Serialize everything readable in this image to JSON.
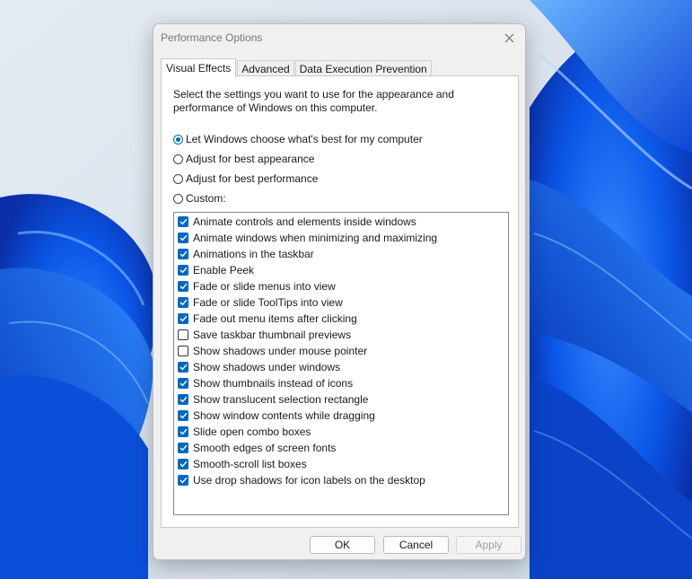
{
  "dialog": {
    "title": "Performance Options",
    "tabs": [
      {
        "label": "Visual Effects",
        "active": true
      },
      {
        "label": "Advanced",
        "active": false
      },
      {
        "label": "Data Execution Prevention",
        "active": false
      }
    ],
    "description": "Select the settings you want to use for the appearance and performance of Windows on this computer.",
    "radios": [
      {
        "label": "Let Windows choose what's best for my computer",
        "checked": true
      },
      {
        "label": "Adjust for best appearance",
        "checked": false
      },
      {
        "label": "Adjust for best performance",
        "checked": false
      },
      {
        "label": "Custom:",
        "checked": false
      }
    ],
    "effects": [
      {
        "label": "Animate controls and elements inside windows",
        "checked": true
      },
      {
        "label": "Animate windows when minimizing and maximizing",
        "checked": true
      },
      {
        "label": "Animations in the taskbar",
        "checked": true
      },
      {
        "label": "Enable Peek",
        "checked": true
      },
      {
        "label": "Fade or slide menus into view",
        "checked": true
      },
      {
        "label": "Fade or slide ToolTips into view",
        "checked": true
      },
      {
        "label": "Fade out menu items after clicking",
        "checked": true
      },
      {
        "label": "Save taskbar thumbnail previews",
        "checked": false
      },
      {
        "label": "Show shadows under mouse pointer",
        "checked": false
      },
      {
        "label": "Show shadows under windows",
        "checked": true
      },
      {
        "label": "Show thumbnails instead of icons",
        "checked": true
      },
      {
        "label": "Show translucent selection rectangle",
        "checked": true
      },
      {
        "label": "Show window contents while dragging",
        "checked": true
      },
      {
        "label": "Slide open combo boxes",
        "checked": true
      },
      {
        "label": "Smooth edges of screen fonts",
        "checked": true
      },
      {
        "label": "Smooth-scroll list boxes",
        "checked": true
      },
      {
        "label": "Use drop shadows for icon labels on the desktop",
        "checked": true
      }
    ],
    "buttons": {
      "ok": "OK",
      "cancel": "Cancel",
      "apply": "Apply"
    }
  },
  "colors": {
    "accent": "#0067c0",
    "wallpaper_blue": "#0a5cf0",
    "wallpaper_light": "#dbe5ee"
  },
  "icons": {
    "close": "close-icon",
    "check": "checkmark-icon"
  }
}
